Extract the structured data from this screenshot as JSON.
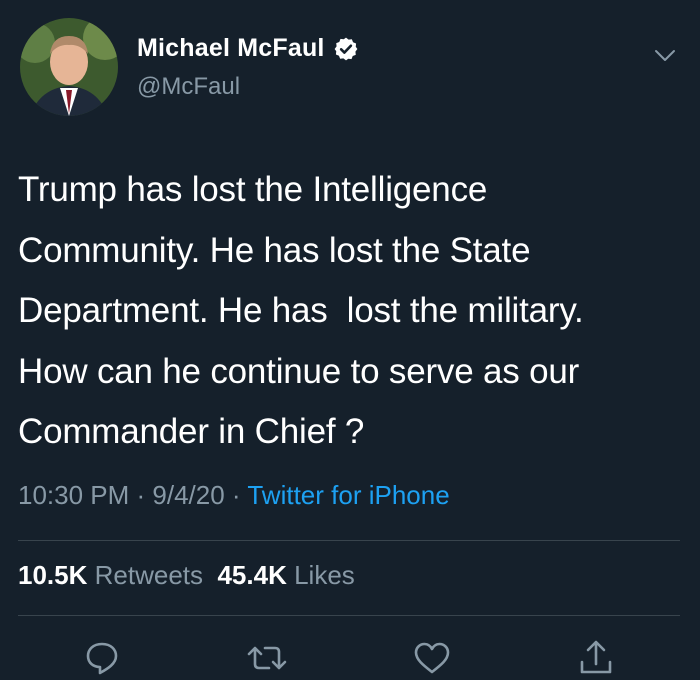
{
  "user": {
    "display_name": "Michael McFaul",
    "handle": "@McFaul"
  },
  "tweet": {
    "text": "Trump has lost the Intelligence\nCommunity. He has lost the State\nDepartment. He has  lost the military.\nHow can he continue to serve as our\nCommander in Chief ?"
  },
  "meta": {
    "time": "10:30 PM",
    "separator": " · ",
    "date": "9/4/20",
    "source": "Twitter for iPhone"
  },
  "stats": {
    "retweets_count": "10.5K",
    "retweets_label": "Retweets",
    "likes_count": "45.4K",
    "likes_label": "Likes"
  },
  "icons": {
    "verified": "verified-badge-icon",
    "caret": "chevron-down-icon",
    "reply": "reply-icon",
    "retweet": "retweet-icon",
    "like": "heart-icon",
    "share": "share-icon"
  },
  "colors": {
    "background": "#15202b",
    "text": "#ffffff",
    "secondary_text": "#8899a6",
    "accent": "#1da1f2",
    "divider": "#38444d"
  }
}
